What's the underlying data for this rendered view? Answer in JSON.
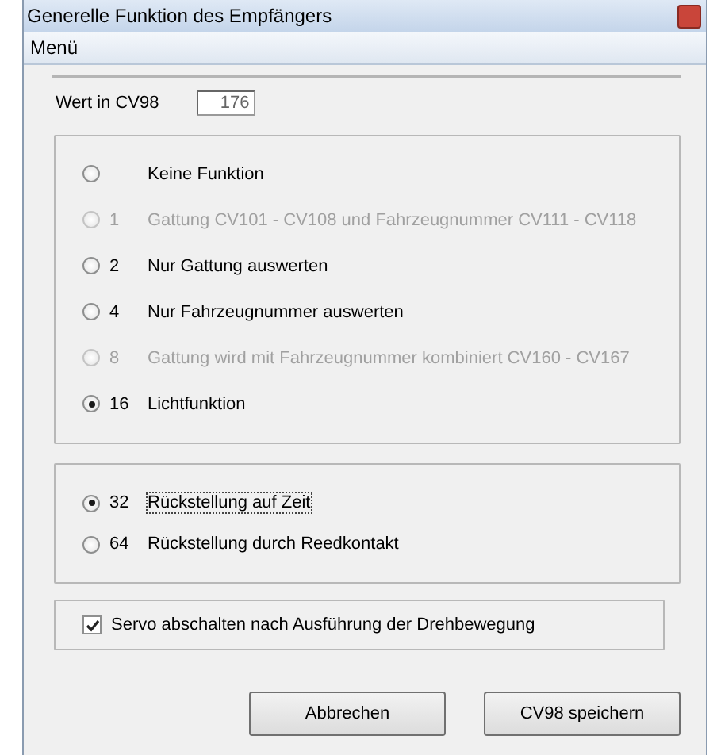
{
  "window": {
    "title": "Generelle Funktion des Empfängers"
  },
  "menu": {
    "label": "Menü"
  },
  "cv_field": {
    "label": "Wert in CV98",
    "value": "176"
  },
  "function_options": [
    {
      "label": "Keine Funktion",
      "selected": false,
      "disabled": false
    },
    {
      "number": "1",
      "label": "Gattung CV101 - CV108 und Fahrzeugnummer CV111 - CV118",
      "selected": false,
      "disabled": true
    },
    {
      "number": "2",
      "label": "Nur Gattung auswerten",
      "selected": false,
      "disabled": false
    },
    {
      "number": "4",
      "label": "Nur Fahrzeugnummer auswerten",
      "selected": false,
      "disabled": false
    },
    {
      "number": "8",
      "label": "Gattung wird mit Fahrzeugnummer kombiniert CV160 - CV167",
      "selected": false,
      "disabled": true
    },
    {
      "number": "16",
      "label": "Lichtfunktion",
      "selected": true,
      "disabled": false
    }
  ],
  "reset_options": [
    {
      "number": "32",
      "label": "Rückstellung auf Zeit",
      "selected": true,
      "disabled": false
    },
    {
      "number": "64",
      "label": "Rückstellung durch Reedkontakt",
      "selected": false,
      "disabled": false
    }
  ],
  "servo_checkbox": {
    "label": "Servo abschalten nach Ausführung der Drehbewegung",
    "checked": true
  },
  "buttons": [
    "Abbrechen",
    "CV98 speichern"
  ]
}
